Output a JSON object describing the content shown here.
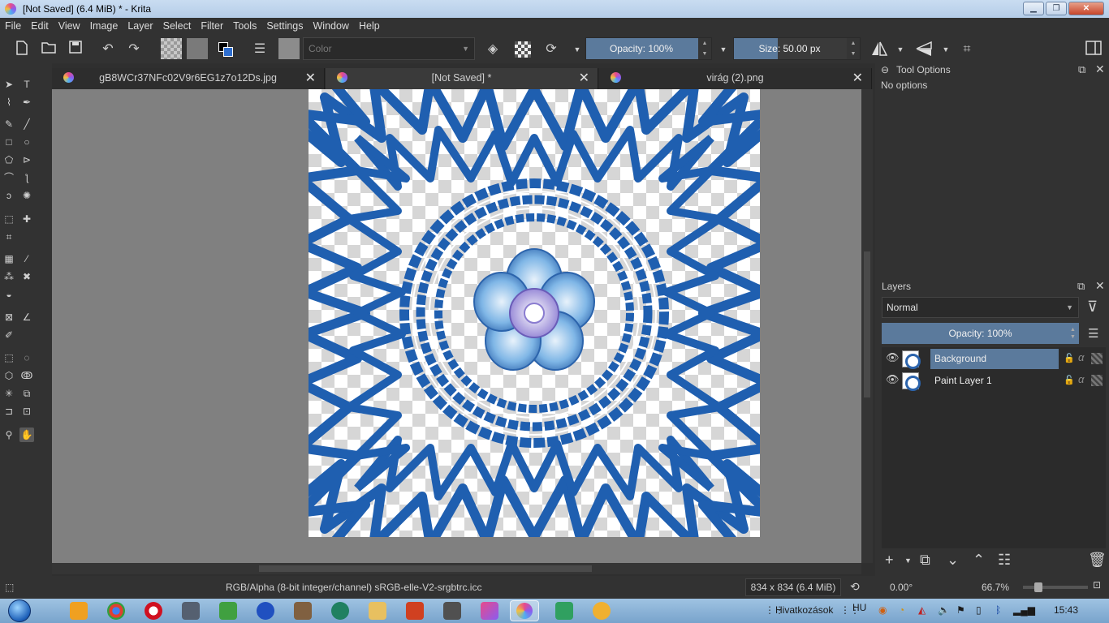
{
  "window": {
    "title": "[Not Saved]  (6.4 MiB)  * - Krita",
    "controls": [
      "▁",
      "❐",
      "✕"
    ]
  },
  "menu": [
    "File",
    "Edit",
    "View",
    "Image",
    "Layer",
    "Select",
    "Filter",
    "Tools",
    "Settings",
    "Window",
    "Help"
  ],
  "toolbar": {
    "blend_placeholder": "Color",
    "opacity": "Opacity: 100%",
    "opacity_fraction": 1.0,
    "size": "Size: 50.00 px",
    "size_fraction": 0.35,
    "icons": [
      "new-document-icon",
      "open-icon",
      "save-icon",
      "undo-icon",
      "redo-icon",
      "fill-pattern-icon",
      "gradient-icon",
      "color-swap-icon",
      "brush-presets-icon",
      "brush-preset-icon",
      "eraser-icon",
      "alpha-lock-icon",
      "reload-icon",
      "mirror-horizontal-icon",
      "mirror-vertical-icon",
      "wrap-around-icon",
      "workspace-icon"
    ]
  },
  "tabs": [
    {
      "label": "gB8WCr37NFc02V9r6EG1z7o12Ds.jpg",
      "active": false
    },
    {
      "label": "[Not Saved]  *",
      "active": true
    },
    {
      "label": "virág (2).png",
      "active": false
    }
  ],
  "tool_options": {
    "title": "Tool Options",
    "content": "No options"
  },
  "layers": {
    "title": "Layers",
    "blend_mode": "Normal",
    "opacity": "Opacity:  100%",
    "items": [
      {
        "name": "Background",
        "selected": true,
        "visible": true
      },
      {
        "name": "Paint Layer 1",
        "selected": false,
        "visible": true
      }
    ]
  },
  "status": {
    "color_space": "RGB/Alpha (8-bit integer/channel)  sRGB-elle-V2-srgbtrc.icc",
    "dimensions": "834 x 834 (6.4 MiB)",
    "rotation": "0.00°",
    "zoom": "66.7%"
  },
  "taskbar": {
    "shortcuts_label": "Hivatkozások",
    "language": "HU",
    "clock": "15:43"
  },
  "colors": {
    "accent": "#5b7a9c",
    "image_blue": "#1f5fb0",
    "fg_color": "#000000",
    "bg_color": "#2f6fd0"
  }
}
